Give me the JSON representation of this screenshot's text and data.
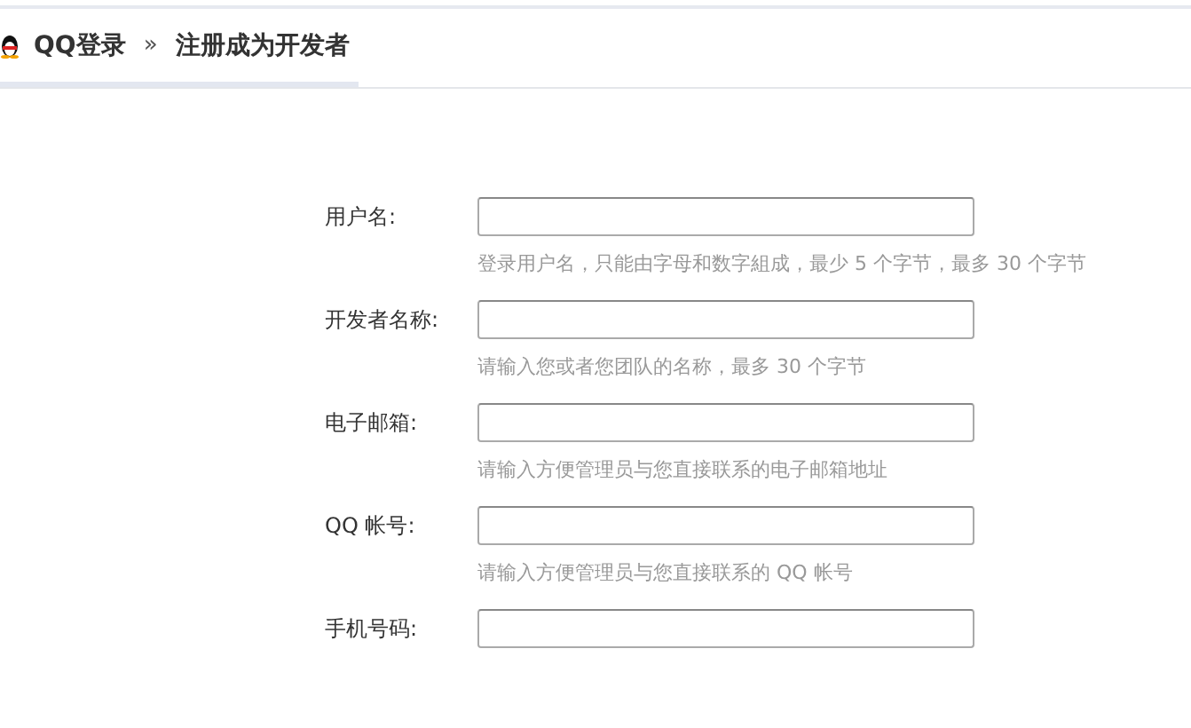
{
  "breadcrumb": {
    "home": "QQ登录",
    "separator": "»",
    "current": "注册成为开发者"
  },
  "fields": [
    {
      "label": "用户名:",
      "hint": "登录用户名，只能由字母和数字組成，最少 5 个字节，最多 30 个字节"
    },
    {
      "label": "开发者名称:",
      "hint": "请输入您或者您团队的名称，最多 30 个字节"
    },
    {
      "label": "电子邮箱:",
      "hint": "请输入方便管理员与您直接联系的电子邮箱地址"
    },
    {
      "label": "QQ 帐号:",
      "hint": "请输入方便管理员与您直接联系的 QQ 帐号"
    },
    {
      "label": "手机号码:"
    }
  ]
}
